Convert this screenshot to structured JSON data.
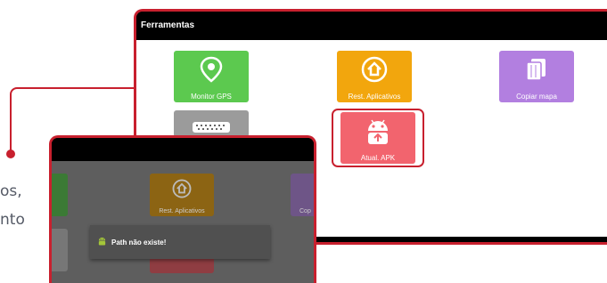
{
  "main_window": {
    "title": "Ferramentas",
    "tiles": [
      {
        "label": "Monitor GPS",
        "icon": "gps-pin-icon",
        "color": "#5cc94f"
      },
      {
        "label": "Rest. Aplicativos",
        "icon": "restore-house-icon",
        "color": "#f2a60d"
      },
      {
        "label": "Copiar mapa",
        "icon": "map-copy-icon",
        "color": "#b27fe0"
      },
      {
        "label": "",
        "icon": "obd-connector-icon",
        "color": "#9b9b9b"
      },
      {
        "label": "Atual. APK",
        "icon": "android-update-icon",
        "color": "#f2646e"
      }
    ]
  },
  "overlay_window": {
    "tiles": [
      {
        "label": "Rest. Aplicativos"
      },
      {
        "label": "Cop"
      }
    ],
    "toast": {
      "message": "Path não existe!",
      "icon": "android-icon"
    }
  },
  "side_text": {
    "line1": "os,",
    "line2": "nto"
  },
  "accent_color": "#c8202e"
}
